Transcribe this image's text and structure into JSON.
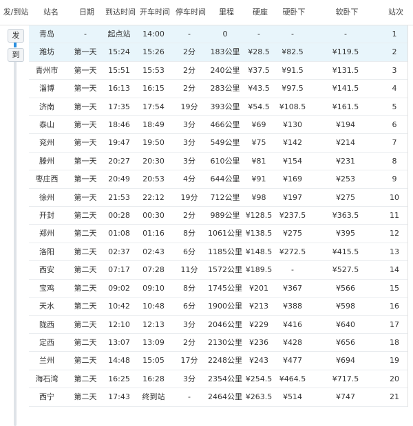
{
  "headers": {
    "dep_arr": "发/到站",
    "station": "站名",
    "date": "日期",
    "arrive": "到达时间",
    "depart": "开车时间",
    "stop": "停车时间",
    "distance": "里程",
    "hard_seat": "硬座",
    "hard_sleeper": "硬卧下",
    "soft_sleeper": "软卧下",
    "no": "站次"
  },
  "rail": {
    "depart_label": "发",
    "arrive_label": "到"
  },
  "rows": [
    {
      "station": "青岛",
      "date": "-",
      "arrive": "起点站",
      "depart": "14:00",
      "stop": "-",
      "distance": "0",
      "hard_seat": "-",
      "hard_sleeper": "-",
      "soft_sleeper": "-",
      "no": "1"
    },
    {
      "station": "潍坊",
      "date": "第一天",
      "arrive": "15:24",
      "depart": "15:26",
      "stop": "2分",
      "distance": "183公里",
      "hard_seat": "¥28.5",
      "hard_sleeper": "¥82.5",
      "soft_sleeper": "¥119.5",
      "no": "2"
    },
    {
      "station": "青州市",
      "date": "第一天",
      "arrive": "15:51",
      "depart": "15:53",
      "stop": "2分",
      "distance": "240公里",
      "hard_seat": "¥37.5",
      "hard_sleeper": "¥91.5",
      "soft_sleeper": "¥131.5",
      "no": "3"
    },
    {
      "station": "淄博",
      "date": "第一天",
      "arrive": "16:13",
      "depart": "16:15",
      "stop": "2分",
      "distance": "283公里",
      "hard_seat": "¥43.5",
      "hard_sleeper": "¥97.5",
      "soft_sleeper": "¥141.5",
      "no": "4"
    },
    {
      "station": "济南",
      "date": "第一天",
      "arrive": "17:35",
      "depart": "17:54",
      "stop": "19分",
      "distance": "393公里",
      "hard_seat": "¥54.5",
      "hard_sleeper": "¥108.5",
      "soft_sleeper": "¥161.5",
      "no": "5"
    },
    {
      "station": "泰山",
      "date": "第一天",
      "arrive": "18:46",
      "depart": "18:49",
      "stop": "3分",
      "distance": "466公里",
      "hard_seat": "¥69",
      "hard_sleeper": "¥130",
      "soft_sleeper": "¥194",
      "no": "6"
    },
    {
      "station": "兖州",
      "date": "第一天",
      "arrive": "19:47",
      "depart": "19:50",
      "stop": "3分",
      "distance": "549公里",
      "hard_seat": "¥75",
      "hard_sleeper": "¥142",
      "soft_sleeper": "¥214",
      "no": "7"
    },
    {
      "station": "滕州",
      "date": "第一天",
      "arrive": "20:27",
      "depart": "20:30",
      "stop": "3分",
      "distance": "610公里",
      "hard_seat": "¥81",
      "hard_sleeper": "¥154",
      "soft_sleeper": "¥231",
      "no": "8"
    },
    {
      "station": "枣庄西",
      "date": "第一天",
      "arrive": "20:49",
      "depart": "20:53",
      "stop": "4分",
      "distance": "644公里",
      "hard_seat": "¥91",
      "hard_sleeper": "¥169",
      "soft_sleeper": "¥253",
      "no": "9"
    },
    {
      "station": "徐州",
      "date": "第一天",
      "arrive": "21:53",
      "depart": "22:12",
      "stop": "19分",
      "distance": "712公里",
      "hard_seat": "¥98",
      "hard_sleeper": "¥197",
      "soft_sleeper": "¥275",
      "no": "10"
    },
    {
      "station": "开封",
      "date": "第二天",
      "arrive": "00:28",
      "depart": "00:30",
      "stop": "2分",
      "distance": "989公里",
      "hard_seat": "¥128.5",
      "hard_sleeper": "¥237.5",
      "soft_sleeper": "¥363.5",
      "no": "11"
    },
    {
      "station": "郑州",
      "date": "第二天",
      "arrive": "01:08",
      "depart": "01:16",
      "stop": "8分",
      "distance": "1061公里",
      "hard_seat": "¥138.5",
      "hard_sleeper": "¥275",
      "soft_sleeper": "¥395",
      "no": "12"
    },
    {
      "station": "洛阳",
      "date": "第二天",
      "arrive": "02:37",
      "depart": "02:43",
      "stop": "6分",
      "distance": "1185公里",
      "hard_seat": "¥148.5",
      "hard_sleeper": "¥272.5",
      "soft_sleeper": "¥415.5",
      "no": "13"
    },
    {
      "station": "西安",
      "date": "第二天",
      "arrive": "07:17",
      "depart": "07:28",
      "stop": "11分",
      "distance": "1572公里",
      "hard_seat": "¥189.5",
      "hard_sleeper": "-",
      "soft_sleeper": "¥527.5",
      "no": "14"
    },
    {
      "station": "宝鸡",
      "date": "第二天",
      "arrive": "09:02",
      "depart": "09:10",
      "stop": "8分",
      "distance": "1745公里",
      "hard_seat": "¥201",
      "hard_sleeper": "¥367",
      "soft_sleeper": "¥566",
      "no": "15"
    },
    {
      "station": "天水",
      "date": "第二天",
      "arrive": "10:42",
      "depart": "10:48",
      "stop": "6分",
      "distance": "1900公里",
      "hard_seat": "¥213",
      "hard_sleeper": "¥388",
      "soft_sleeper": "¥598",
      "no": "16"
    },
    {
      "station": "陇西",
      "date": "第二天",
      "arrive": "12:10",
      "depart": "12:13",
      "stop": "3分",
      "distance": "2046公里",
      "hard_seat": "¥229",
      "hard_sleeper": "¥416",
      "soft_sleeper": "¥640",
      "no": "17"
    },
    {
      "station": "定西",
      "date": "第二天",
      "arrive": "13:07",
      "depart": "13:09",
      "stop": "2分",
      "distance": "2130公里",
      "hard_seat": "¥236",
      "hard_sleeper": "¥428",
      "soft_sleeper": "¥656",
      "no": "18"
    },
    {
      "station": "兰州",
      "date": "第二天",
      "arrive": "14:48",
      "depart": "15:05",
      "stop": "17分",
      "distance": "2248公里",
      "hard_seat": "¥243",
      "hard_sleeper": "¥477",
      "soft_sleeper": "¥694",
      "no": "19"
    },
    {
      "station": "海石湾",
      "date": "第二天",
      "arrive": "16:25",
      "depart": "16:28",
      "stop": "3分",
      "distance": "2354公里",
      "hard_seat": "¥254.5",
      "hard_sleeper": "¥464.5",
      "soft_sleeper": "¥717.5",
      "no": "20"
    },
    {
      "station": "西宁",
      "date": "第二天",
      "arrive": "17:43",
      "depart": "终到站",
      "stop": "-",
      "distance": "2464公里",
      "hard_seat": "¥263.5",
      "hard_sleeper": "¥514",
      "soft_sleeper": "¥747",
      "no": "21"
    }
  ]
}
